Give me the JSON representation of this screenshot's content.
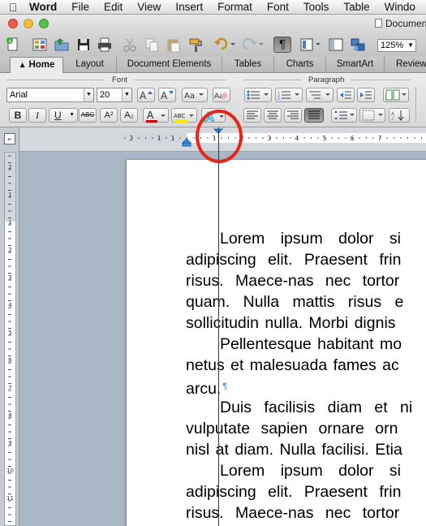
{
  "menubar": {
    "items": [
      "Word",
      "File",
      "Edit",
      "View",
      "Insert",
      "Format",
      "Font",
      "Tools",
      "Table",
      "Windo"
    ]
  },
  "window": {
    "title": "Documen"
  },
  "toolbar": {
    "zoom": "125%"
  },
  "ribbon": {
    "tabs": [
      "Home",
      "Layout",
      "Document Elements",
      "Tables",
      "Charts",
      "SmartArt",
      "Review"
    ],
    "groups": {
      "font": "Font",
      "paragraph": "Paragraph"
    },
    "font_name": "Arial",
    "font_size": "20",
    "buttons": {
      "bold": "B",
      "italic": "I",
      "underline": "U",
      "strike": "ABC",
      "superscript": "A²",
      "subscript": "A₂",
      "text_effects": "A"
    }
  },
  "ruler": {
    "labels": [
      "2",
      "1",
      "1",
      "1",
      "2",
      "3",
      "4",
      "5",
      "6",
      "7"
    ],
    "vlabels": [
      "2",
      "1",
      "1",
      "2",
      "3",
      "4",
      "5",
      "6",
      "7",
      "8",
      "9",
      "10",
      "11"
    ]
  },
  "document": {
    "paragraphs": [
      {
        "lines": [
          "Lorem ipsum dolor si",
          "adipiscing elit. Praesent frin",
          "risus. Maece-nas nec tortor",
          "quam. Nulla mattis risus e",
          "sollicitudin nulla. Morbi dignis"
        ]
      },
      {
        "lines": [
          "Pellentesque habitant mo",
          "netus et malesuada fames ac",
          "arcu."
        ],
        "pilcrow": "¶"
      },
      {
        "lines": [
          "Duis facilisis diam et ni",
          "vulputate sapien ornare orn",
          "nisl at diam. Nulla facilisi. Etia"
        ]
      },
      {
        "lines": [
          "Lorem ipsum dolor si",
          "adipiscing elit. Praesent frin",
          "risus. Maece-nas nec tortor"
        ]
      }
    ]
  },
  "colors": {
    "accent_circle": "#e82418",
    "font_color_bar": "#d40000",
    "highlight_bar": "#ffe800"
  }
}
